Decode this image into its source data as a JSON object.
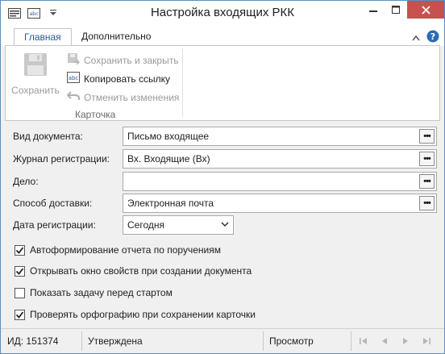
{
  "window": {
    "title": "Настройка входящих РКК",
    "qat_icons": [
      "card-icon",
      "abc-icon",
      "dropdown-arrow-icon"
    ],
    "controls": [
      "minimize-icon",
      "maximize-icon",
      "close-icon"
    ]
  },
  "ribbon": {
    "tabs": [
      {
        "label": "Главная",
        "active": true
      },
      {
        "label": "Дополнительно",
        "active": false
      }
    ],
    "buttons": {
      "save": "Сохранить",
      "save_close": "Сохранить и закрыть",
      "copy_link": "Копировать ссылку",
      "undo": "Отменить изменения"
    },
    "group_label": "Карточка"
  },
  "form": {
    "doc_type": {
      "label": "Вид документа:",
      "value": "Письмо входящее"
    },
    "journal": {
      "label": "Журнал регистрации:",
      "value": "Вх. Входящие (Вх)"
    },
    "case": {
      "label": "Дело:",
      "value": ""
    },
    "delivery": {
      "label": "Способ доставки:",
      "value": "Электронная почта"
    },
    "reg_date": {
      "label": "Дата регистрации:",
      "value": "Сегодня"
    },
    "checkboxes": [
      {
        "label": "Автоформирование отчета по поручениям",
        "checked": true
      },
      {
        "label": "Открывать окно свойств при создании документа",
        "checked": true
      },
      {
        "label": "Показать задачу перед стартом",
        "checked": false
      },
      {
        "label": "Проверять орфографию при сохранении карточки",
        "checked": true
      }
    ]
  },
  "statusbar": {
    "id": "ИД: 151374",
    "status": "Утверждена",
    "mode": "Просмотр"
  },
  "colors": {
    "accent": "#2b5797",
    "close_button": "#c75050",
    "border": "#5a8fbf"
  }
}
